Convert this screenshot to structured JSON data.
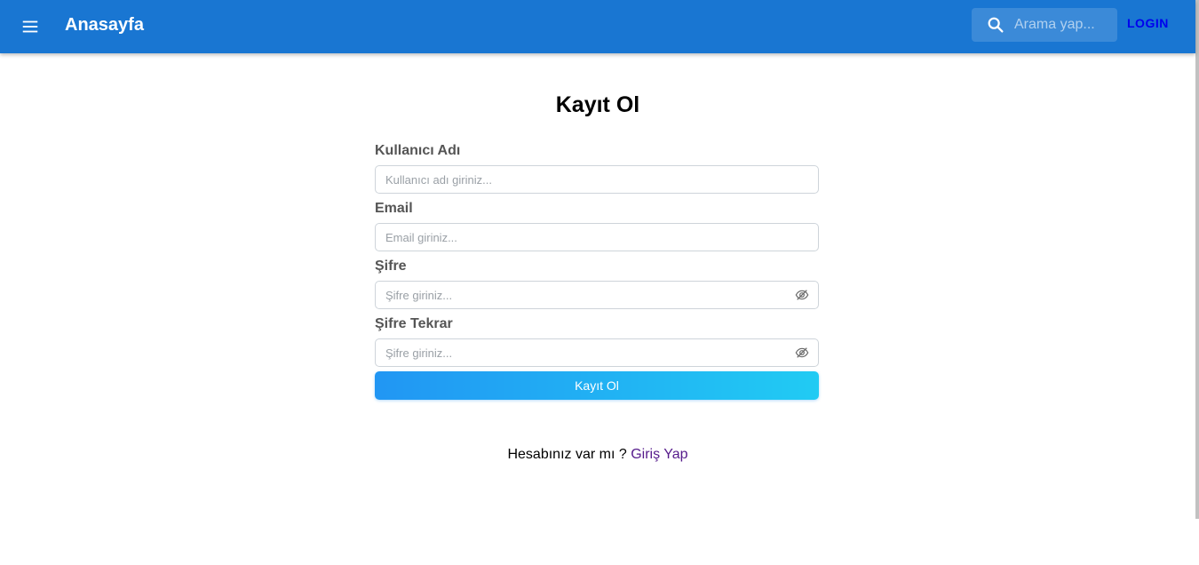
{
  "appbar": {
    "menu_icon": "menu-icon",
    "title": "Anasayfa",
    "search": {
      "icon": "search-icon",
      "placeholder": "Arama yap..."
    },
    "login_label": "LOGIN",
    "colors": {
      "background": "#1976d2",
      "login": "#0000ee"
    }
  },
  "form": {
    "title": "Kayıt Ol",
    "fields": [
      {
        "label": "Kullanıcı Adı",
        "placeholder": "Kullanıcı adı giriniz..."
      },
      {
        "label": "Email",
        "placeholder": "Email giriniz..."
      },
      {
        "label": "Şifre",
        "placeholder": "Şifre giriniz...",
        "icon": "eye-off-icon"
      },
      {
        "label": "Şifre Tekrar",
        "placeholder": "Şifre giriniz...",
        "icon": "eye-off-icon"
      }
    ],
    "submit_label": "Kayıt Ol",
    "submit_gradient": [
      "#2196f3",
      "#21cbf3"
    ]
  },
  "footer": {
    "question": "Hesabınız var mı ?",
    "link_label": "Giriş Yap"
  }
}
